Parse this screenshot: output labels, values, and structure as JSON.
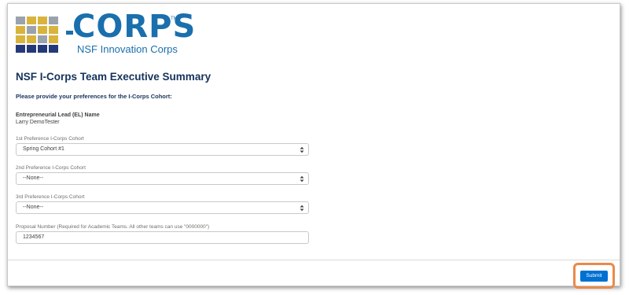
{
  "logo": {
    "word": "CORPS",
    "subtitle": "NSF Innovation Corps",
    "trademark": "TM",
    "colors": {
      "blue": "#1a6fad",
      "gold": "#d8b43c",
      "gray": "#9aa3ad",
      "navy": "#243a78"
    }
  },
  "page": {
    "title": "NSF I-Corps Team Executive Summary",
    "subtitle": "Please provide your preferences for the I-Corps Cohort:"
  },
  "entrepreneurial_lead": {
    "label": "Entrepreneurial Lead (EL) Name",
    "value": "Larry DemoTester"
  },
  "fields": {
    "pref1": {
      "label": "1st Preference I-Corps Cohort",
      "value": "Spring Cohort #1"
    },
    "pref2": {
      "label": "2nd Preference I-Corps Cohort",
      "value": "--None--"
    },
    "pref3": {
      "label": "3rd Preference I-Corps Cohort",
      "value": "--None--"
    },
    "proposal": {
      "label": "Proposal Number (Required for Academic Teams. All other teams can use \"0000000\")",
      "value": "1234567"
    }
  },
  "actions": {
    "submit_label": "Submit"
  },
  "colors": {
    "accent": "#0070d2",
    "highlight": "#e98a4b",
    "title": "#16325c"
  }
}
